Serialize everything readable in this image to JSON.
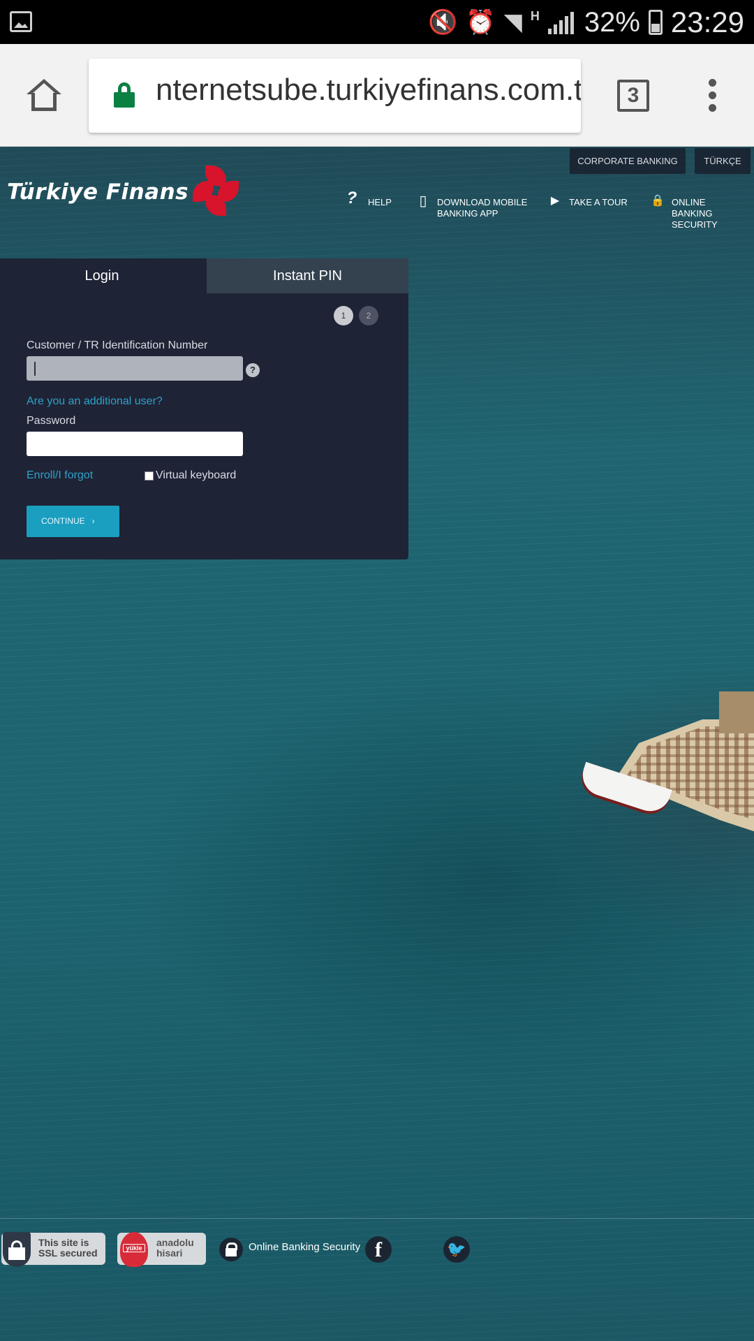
{
  "status_bar": {
    "icons": [
      "gallery-icon",
      "mute-icon",
      "alarm-icon",
      "wifi-icon",
      "signal-icon",
      "battery-icon"
    ],
    "network_type": "H",
    "battery": "32%",
    "time": "23:29"
  },
  "browser": {
    "url": "nternetsube.turkiyefinans.com.tr",
    "tab_count": "3",
    "colors": {
      "lock": "#0b8043",
      "toolbar": "#f2f2f2"
    }
  },
  "header": {
    "logo_text": "Türkiye Finans",
    "corporate_banking": "CORPORATE BANKING",
    "language": "TÜRKÇE",
    "nav": {
      "help": "HELP",
      "download_1": "DOWNLOAD MOBILE",
      "download_2": "BANKING APP",
      "tour": "TAKE A TOUR",
      "security_1": "ONLINE",
      "security_2": "BANKING SECURITY"
    }
  },
  "login": {
    "tabs": {
      "login": "Login",
      "instant_pin": "Instant PIN"
    },
    "steps": [
      "1",
      "2"
    ],
    "customer_label": "Customer / TR Identification Number",
    "customer_value": "",
    "help_mark": "?",
    "additional_user": "Are you an additional user?",
    "password_label": "Password",
    "password_value": "",
    "enroll_forgot": "Enroll/I forgot",
    "virtual_keyboard": "Virtual keyboard",
    "virtual_keyboard_checked": false,
    "continue": "CONTINUE",
    "continue_chevron": "›",
    "colors": {
      "panel": "#1e2336",
      "accent": "#1a9fc1",
      "link": "#2ea3c8"
    }
  },
  "footer": {
    "ssl_1": "This site is",
    "ssl_2": "SSL secured",
    "ah_badge_icon": "yükle",
    "ah_1": "anadolu",
    "ah_2": "hisari",
    "security": "Online Banking Security",
    "facebook": "f",
    "twitter": "twitter-icon"
  }
}
